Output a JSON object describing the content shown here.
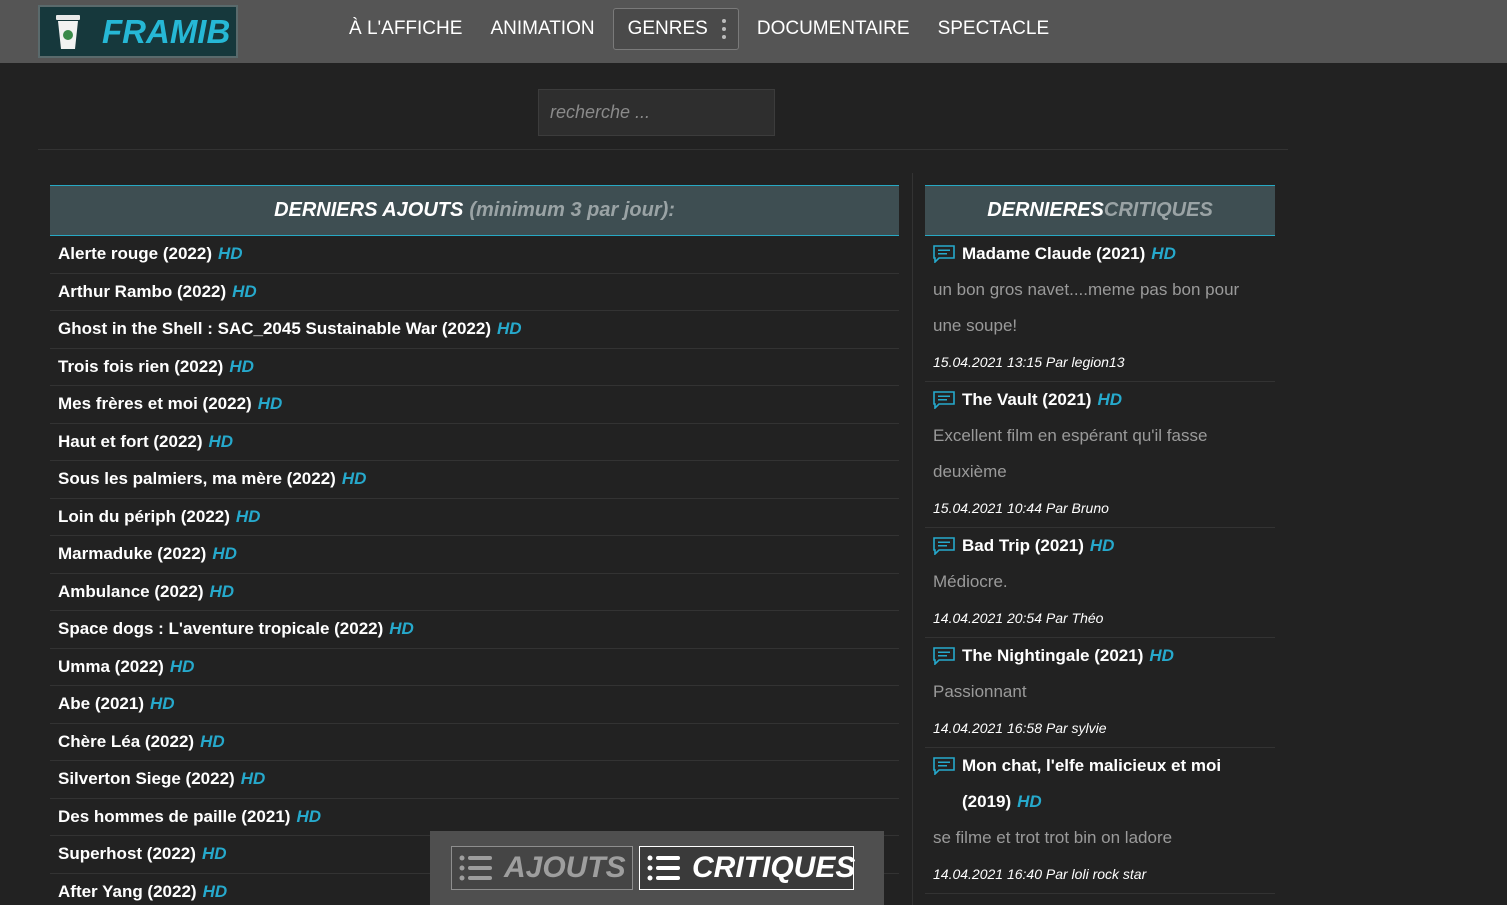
{
  "brand": {
    "name": "FRAMIB",
    "accent": "#26b8d6"
  },
  "nav": {
    "items": [
      "À L'AFFICHE",
      "ANIMATION",
      "GENRES",
      "DOCUMENTAIRE",
      "SPECTACLE"
    ]
  },
  "search": {
    "placeholder": "recherche ..."
  },
  "left": {
    "title": "DERNIERS AJOUTS",
    "subtitle": "(minimum 3 par jour):",
    "hd": "HD",
    "items": [
      "Alerte rouge (2022)",
      "Arthur Rambo (2022)",
      "Ghost in the Shell : SAC_2045 Sustainable War (2022)",
      "Trois fois rien (2022)",
      "Mes frères et moi (2022)",
      "Haut et fort (2022)",
      "Sous les palmiers, ma mère (2022)",
      "Loin du périph (2022)",
      "Marmaduke (2022)",
      "Ambulance (2022)",
      "Space dogs : L'aventure tropicale (2022)",
      "Umma (2022)",
      "Abe (2021)",
      "Chère Léa (2022)",
      "Silverton Siege (2022)",
      "Des hommes de paille (2021)",
      "Superhost (2022)",
      "After Yang (2022)"
    ]
  },
  "right": {
    "title": "DERNIERES",
    "title2": " CRITIQUES",
    "hd": "HD",
    "items": [
      {
        "title": "Madame Claude (2021)",
        "text": "un bon gros navet....meme pas bon pour une soupe!",
        "meta": "15.04.2021 13:15 Par legion13"
      },
      {
        "title": "The Vault (2021)",
        "text": "Excellent film en espérant qu'il fasse deuxième",
        "meta": "15.04.2021 10:44 Par Bruno"
      },
      {
        "title": "Bad Trip (2021)",
        "text": "Médiocre.",
        "meta": "14.04.2021 20:54 Par Théo"
      },
      {
        "title": "The Nightingale (2021)",
        "text": "Passionnant",
        "meta": "14.04.2021 16:58 Par sylvie"
      },
      {
        "title": "Mon chat, l'elfe malicieux et moi (2019)",
        "text": "se filme et trot trot bin on ladore",
        "meta": "14.04.2021 16:40 Par loli rock star"
      }
    ]
  },
  "bottom": {
    "ajouts_label": "AJOUTS",
    "critiques_label": "CRITIQUES"
  }
}
